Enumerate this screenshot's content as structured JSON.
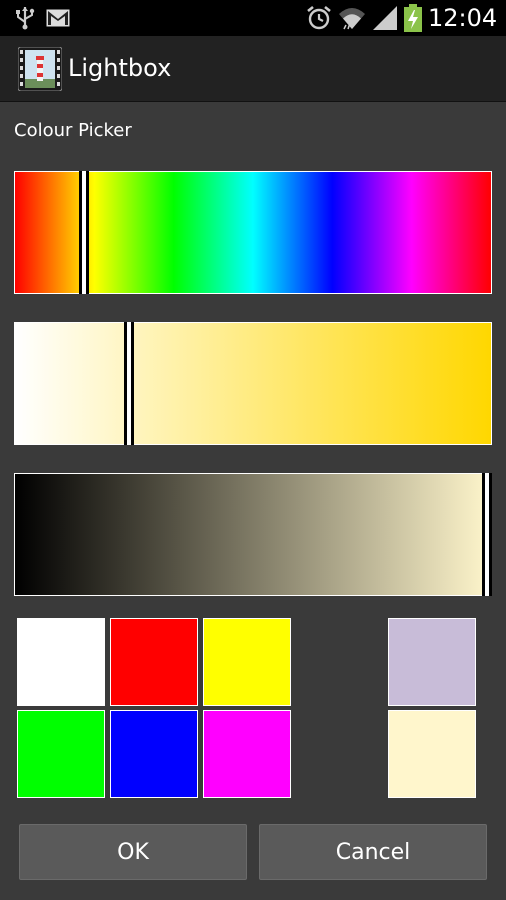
{
  "status_bar": {
    "time": "12:04"
  },
  "action_bar": {
    "title": "Lightbox"
  },
  "picker": {
    "title": "Colour Picker",
    "hue_position": 0.145,
    "saturation_position": 0.24,
    "value_position": 1.0
  },
  "swatches": [
    {
      "name": "white",
      "color": "#ffffff"
    },
    {
      "name": "red",
      "color": "#ff0000"
    },
    {
      "name": "yellow",
      "color": "#ffff00"
    },
    {
      "name": "green",
      "color": "#00ff00"
    },
    {
      "name": "blue",
      "color": "#0000ff"
    },
    {
      "name": "magenta",
      "color": "#ff00ff"
    }
  ],
  "preview": {
    "old_color": "#c8bcd8",
    "new_color": "#fff6cc"
  },
  "buttons": {
    "ok": "OK",
    "cancel": "Cancel"
  }
}
